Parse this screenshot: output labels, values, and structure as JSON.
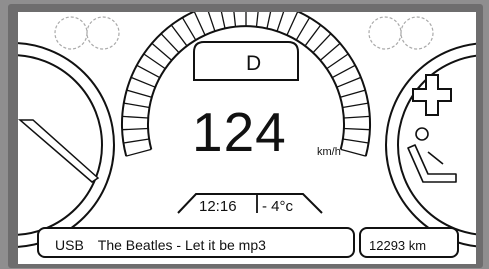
{
  "drive": {
    "gear": "D",
    "speed": "124",
    "speed_unit": "km/h",
    "time": "12:16",
    "temperature": "- 4°c"
  },
  "media": {
    "source": "USB",
    "track": "The Beatles - Let it be mp3"
  },
  "odometer": "12293 km",
  "icons": [
    "indicator-lamp-icon",
    "tachometer-gauge-icon",
    "needle-icon",
    "cross-icon",
    "seat-icon"
  ],
  "colors": {
    "display_background": "#ffffff",
    "line_color": "#111111",
    "bezel": "#6e6d6e"
  }
}
